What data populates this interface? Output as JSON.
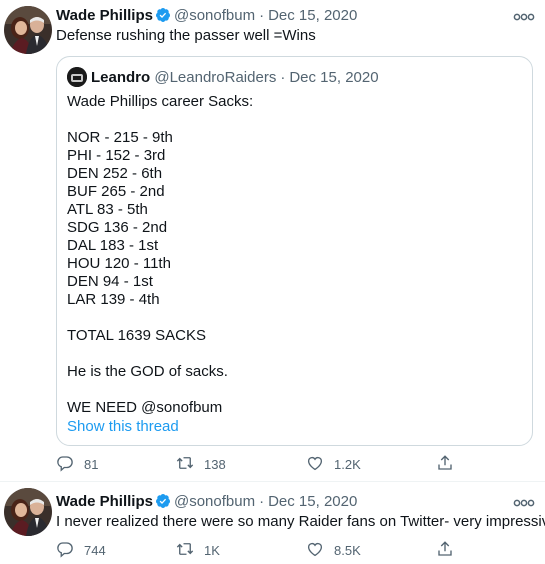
{
  "tweets": [
    {
      "author_name": "Wade Phillips",
      "handle": "@sonofbum",
      "separator": "·",
      "date": "Dec 15, 2020",
      "text": "Defense rushing the passer well =Wins",
      "quote": {
        "author_name": "Leandro",
        "handle": "@LeandroRaiders",
        "separator": "·",
        "date": "Dec 15, 2020",
        "lines": [
          "Wade Phillips career Sacks:",
          "",
          "NOR - 215 - 9th",
          "PHI - 152 - 3rd",
          "DEN 252 - 6th",
          "BUF 265 - 2nd",
          "ATL 83 - 5th",
          "SDG 136 - 2nd",
          "DAL 183 - 1st",
          "HOU 120 - 11th",
          "DEN 94 - 1st",
          "LAR 139 - 4th",
          "",
          "TOTAL 1639 SACKS",
          "",
          "He is the GOD of sacks.",
          "",
          "WE NEED @sonofbum"
        ],
        "show_thread": "Show this thread"
      },
      "replies": "81",
      "retweets": "138",
      "likes": "1.2K"
    },
    {
      "author_name": "Wade Phillips",
      "handle": "@sonofbum",
      "separator": "·",
      "date": "Dec 15, 2020",
      "text": "I never realized there were so many Raider fans on Twitter- very impressive.",
      "replies": "744",
      "retweets": "1K",
      "likes": "8.5K"
    }
  ],
  "colors": {
    "accent": "#1d9bf0",
    "muted": "#536471",
    "text": "#0f1419",
    "border": "#cfd9de"
  },
  "icons": [
    "verified-badge-icon",
    "more-icon",
    "reply-icon",
    "retweet-icon",
    "like-icon",
    "share-icon"
  ]
}
